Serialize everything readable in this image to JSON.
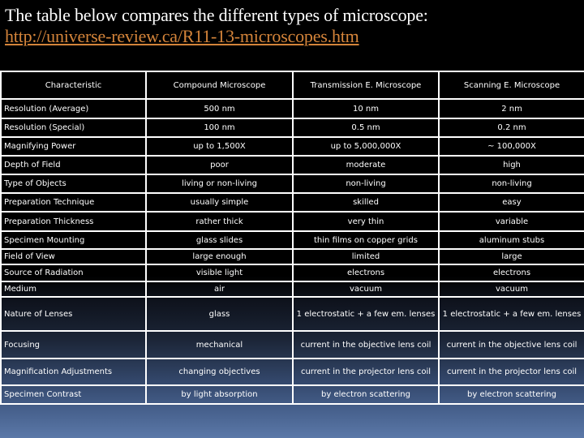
{
  "intro": {
    "text": "The table below compares the different types of microscope:",
    "link": "http://universe-review.ca/R11-13-microscopes.htm"
  },
  "table": {
    "headers": [
      "Characteristic",
      "Compound Microscope",
      "Transmission E. Microscope",
      "Scanning E. Microscope"
    ],
    "rows": [
      [
        "Resolution (Average)",
        "500 nm",
        "10 nm",
        "2 nm"
      ],
      [
        "Resolution (Special)",
        "100 nm",
        "0.5 nm",
        "0.2 nm"
      ],
      [
        "Magnifying Power",
        "up to 1,500X",
        "up to 5,000,000X",
        "~ 100,000X"
      ],
      [
        "Depth of Field",
        "poor",
        "moderate",
        "high"
      ],
      [
        "Type of Objects",
        "living or non-living",
        "non-living",
        "non-living"
      ],
      [
        "Preparation Technique",
        "usually simple",
        "skilled",
        "easy"
      ],
      [
        "Preparation Thickness",
        "rather thick",
        "very thin",
        "variable"
      ],
      [
        "Specimen Mounting",
        "glass slides",
        "thin films on copper grids",
        "aluminum stubs"
      ],
      [
        "Field of View",
        "large enough",
        "limited",
        "large"
      ],
      [
        "Source of Radiation",
        "visible light",
        "electrons",
        "electrons"
      ],
      [
        "Medium",
        "air",
        "vacuum",
        "vacuum"
      ],
      [
        "Nature of Lenses",
        "glass",
        "1 electrostatic + a few em. lenses",
        "1 electrostatic + a few em. lenses"
      ],
      [
        "Focusing",
        "mechanical",
        "current in the objective lens coil",
        "current in the objective lens coil"
      ],
      [
        "Magnification Adjustments",
        "changing objectives",
        "current in the projector lens coil",
        "current in the projector lens coil"
      ],
      [
        "Specimen Contrast",
        "by light absorption",
        "by electron scattering",
        "by electron scattering"
      ]
    ]
  }
}
